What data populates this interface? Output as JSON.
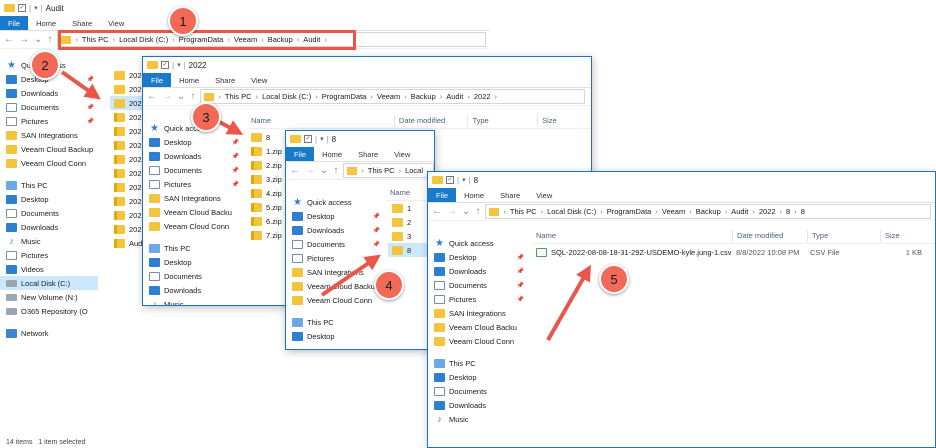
{
  "windows": {
    "w1": {
      "title": "Audit",
      "ribbon": [
        "File",
        "Home",
        "Share",
        "View"
      ],
      "path": [
        "This PC",
        "Local Disk (C:)",
        "ProgramData",
        "Veeam",
        "Backup",
        "Audit"
      ],
      "sidebar": [
        {
          "label": "Quick access",
          "icon": "star-icon"
        },
        {
          "label": "Desktop",
          "icon": "desktop-icon",
          "pin": true
        },
        {
          "label": "Downloads",
          "icon": "download-icon",
          "pin": true
        },
        {
          "label": "Documents",
          "icon": "documents-icon",
          "pin": true
        },
        {
          "label": "Pictures",
          "icon": "pictures-icon",
          "pin": true
        },
        {
          "label": "SAN Integrations",
          "icon": "folder-icon"
        },
        {
          "label": "Veeam Cloud Backup",
          "icon": "folder-icon"
        },
        {
          "label": "Veeam Cloud Conn",
          "icon": "folder-icon"
        },
        {
          "label": "",
          "icon": ""
        },
        {
          "label": "This PC",
          "icon": "pc-icon"
        },
        {
          "label": "Desktop",
          "icon": "desktop-icon"
        },
        {
          "label": "Documents",
          "icon": "documents-icon"
        },
        {
          "label": "Downloads",
          "icon": "download-icon"
        },
        {
          "label": "Music",
          "icon": "music-icon"
        },
        {
          "label": "Pictures",
          "icon": "pictures-icon"
        },
        {
          "label": "Videos",
          "icon": "videos-icon"
        },
        {
          "label": "Local Disk (C:)",
          "icon": "drive-icon",
          "selected": true
        },
        {
          "label": "New Volume (N:)",
          "icon": "drive-icon"
        },
        {
          "label": "O365 Repository (O",
          "icon": "drive-icon"
        },
        {
          "label": "",
          "icon": ""
        },
        {
          "label": "Network",
          "icon": "network-icon"
        }
      ],
      "files": [
        {
          "name": "2020",
          "icon": "folder-icon"
        },
        {
          "name": "2021",
          "icon": "folder-icon"
        },
        {
          "name": "2022",
          "icon": "folder-icon",
          "selected": true
        },
        {
          "name": "2022-0",
          "icon": "zip-icon"
        },
        {
          "name": "2022-0",
          "icon": "zip-icon"
        },
        {
          "name": "2022-0",
          "icon": "zip-icon"
        },
        {
          "name": "2022-0",
          "icon": "zip-icon"
        },
        {
          "name": "2022-0",
          "icon": "zip-icon"
        },
        {
          "name": "2022-0",
          "icon": "zip-icon"
        },
        {
          "name": "2022-0",
          "icon": "zip-icon"
        },
        {
          "name": "2022-0",
          "icon": "zip-icon"
        },
        {
          "name": "2022-0",
          "icon": "zip-icon"
        },
        {
          "name": "Audit.2",
          "icon": "zip-icon"
        }
      ],
      "status_items": "14 items",
      "status_selected": "1 item selected"
    },
    "w2": {
      "title": "2022",
      "ribbon": [
        "File",
        "Home",
        "Share",
        "View"
      ],
      "path": [
        "This PC",
        "Local Disk (C:)",
        "ProgramData",
        "Veeam",
        "Backup",
        "Audit",
        "2022"
      ],
      "columns": [
        "Name",
        "Date modified",
        "Type",
        "Size"
      ],
      "sidebar": [
        {
          "label": "Quick access",
          "icon": "star-icon"
        },
        {
          "label": "Desktop",
          "icon": "desktop-icon",
          "pin": true
        },
        {
          "label": "Downloads",
          "icon": "download-icon",
          "pin": true
        },
        {
          "label": "Documents",
          "icon": "documents-icon",
          "pin": true
        },
        {
          "label": "Pictures",
          "icon": "pictures-icon",
          "pin": true
        },
        {
          "label": "SAN Integrations",
          "icon": "folder-icon"
        },
        {
          "label": "Veeam Cloud Backu",
          "icon": "folder-icon"
        },
        {
          "label": "Veeam Cloud Conn",
          "icon": "folder-icon"
        },
        {
          "label": "",
          "icon": ""
        },
        {
          "label": "This PC",
          "icon": "pc-icon"
        },
        {
          "label": "Desktop",
          "icon": "desktop-icon"
        },
        {
          "label": "Documents",
          "icon": "documents-icon"
        },
        {
          "label": "Downloads",
          "icon": "download-icon"
        },
        {
          "label": "Music",
          "icon": "music-icon"
        }
      ],
      "files": [
        {
          "name": "8",
          "icon": "folder-icon"
        },
        {
          "name": "1.zip",
          "icon": "zip-icon"
        },
        {
          "name": "2.zip",
          "icon": "zip-icon"
        },
        {
          "name": "3.zip",
          "icon": "zip-icon"
        },
        {
          "name": "4.zip",
          "icon": "zip-icon"
        },
        {
          "name": "5.zip",
          "icon": "zip-icon"
        },
        {
          "name": "6.zip",
          "icon": "zip-icon"
        },
        {
          "name": "7.zip",
          "icon": "zip-icon"
        }
      ]
    },
    "w3": {
      "title": "8",
      "ribbon": [
        "File",
        "Home",
        "Share",
        "View"
      ],
      "path": [
        "This PC",
        "Local"
      ],
      "columns": [
        "Name"
      ],
      "sidebar": [
        {
          "label": "Quick access",
          "icon": "star-icon"
        },
        {
          "label": "Desktop",
          "icon": "desktop-icon",
          "pin": true
        },
        {
          "label": "Downloads",
          "icon": "download-icon",
          "pin": true
        },
        {
          "label": "Documents",
          "icon": "documents-icon",
          "pin": true
        },
        {
          "label": "Pictures",
          "icon": "pictures-icon"
        },
        {
          "label": "SAN Integrations",
          "icon": "folder-icon"
        },
        {
          "label": "Veeam Cloud Backu",
          "icon": "folder-icon"
        },
        {
          "label": "Veeam Cloud Conn",
          "icon": "folder-icon"
        },
        {
          "label": "",
          "icon": ""
        },
        {
          "label": "This PC",
          "icon": "pc-icon"
        },
        {
          "label": "Desktop",
          "icon": "desktop-icon"
        }
      ],
      "files": [
        {
          "name": "1",
          "icon": "folder-icon"
        },
        {
          "name": "2",
          "icon": "folder-icon"
        },
        {
          "name": "3",
          "icon": "folder-icon"
        },
        {
          "name": "8",
          "icon": "folder-icon",
          "selected": true
        }
      ]
    },
    "w4": {
      "title": "8",
      "ribbon": [
        "File",
        "Home",
        "Share",
        "View"
      ],
      "path": [
        "This PC",
        "Local Disk (C:)",
        "ProgramData",
        "Veeam",
        "Backup",
        "Audit",
        "2022",
        "8",
        "8"
      ],
      "columns": [
        "Name",
        "Date modified",
        "Type",
        "Size"
      ],
      "sidebar": [
        {
          "label": "Quick access",
          "icon": "star-icon"
        },
        {
          "label": "Desktop",
          "icon": "desktop-icon",
          "pin": true
        },
        {
          "label": "Downloads",
          "icon": "download-icon",
          "pin": true
        },
        {
          "label": "Documents",
          "icon": "documents-icon",
          "pin": true
        },
        {
          "label": "Pictures",
          "icon": "pictures-icon",
          "pin": true
        },
        {
          "label": "SAN Integrations",
          "icon": "folder-icon"
        },
        {
          "label": "Veeam Cloud Backu",
          "icon": "folder-icon"
        },
        {
          "label": "Veeam Cloud Conn",
          "icon": "folder-icon"
        },
        {
          "label": "",
          "icon": ""
        },
        {
          "label": "This PC",
          "icon": "pc-icon"
        },
        {
          "label": "Desktop",
          "icon": "desktop-icon"
        },
        {
          "label": "Documents",
          "icon": "documents-icon"
        },
        {
          "label": "Downloads",
          "icon": "download-icon"
        },
        {
          "label": "Music",
          "icon": "music-icon"
        }
      ],
      "files": [
        {
          "name": "SQL-2022-08-08-18-31-29Z-USDEMO-kyle.jung-1.csv",
          "date": "8/8/2022 10:08 PM",
          "type": "CSV File",
          "size": "1 KB",
          "icon": "csv-icon"
        }
      ]
    }
  },
  "badges": [
    "1",
    "2",
    "3",
    "4",
    "5"
  ],
  "colors": {
    "accent": "#1979ca",
    "annotation": "#f26a57",
    "highlight_box": "#e8574a",
    "selection": "#cce8ff",
    "folder": "#f3c43d"
  }
}
